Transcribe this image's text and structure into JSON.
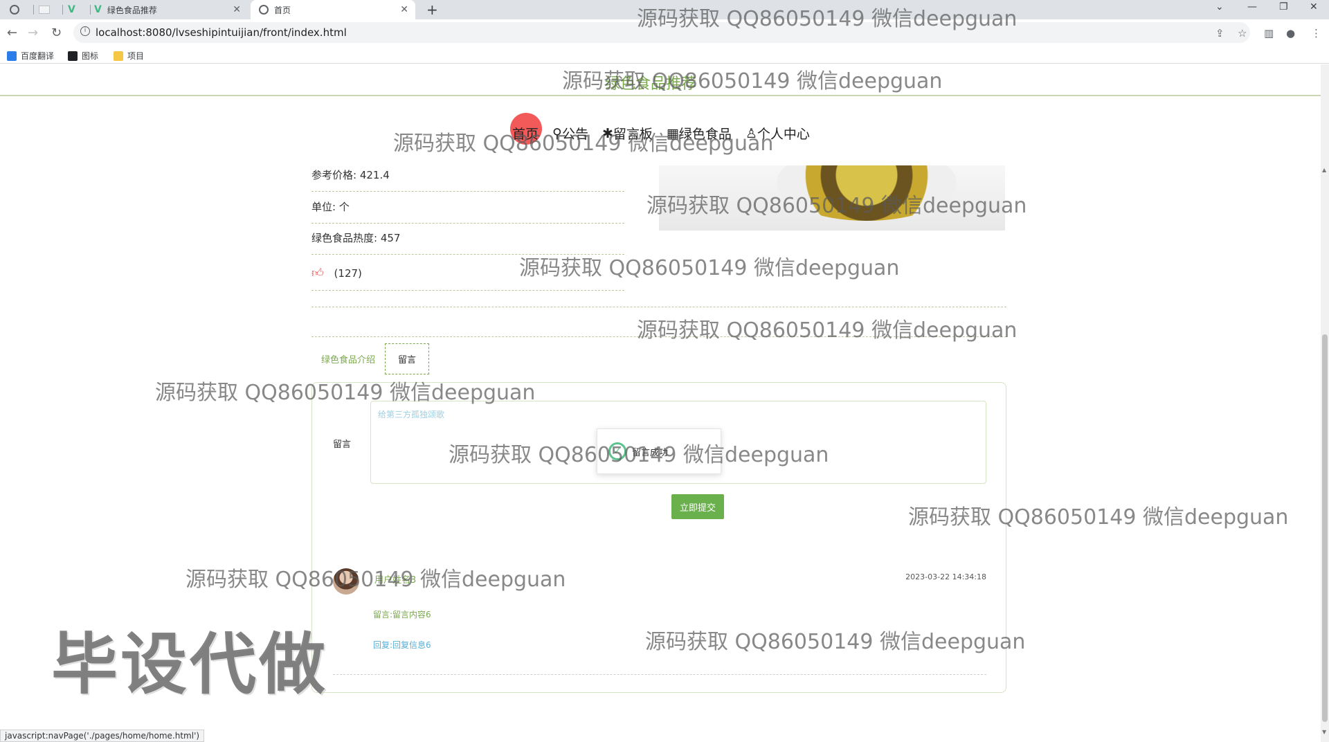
{
  "browser": {
    "tabs": [
      {
        "title": ""
      },
      {
        "title": ""
      },
      {
        "title": ""
      },
      {
        "title": "绿色食品推荐"
      },
      {
        "title": "首页"
      }
    ],
    "url": "localhost:8080/lvseshipintuijian/front/index.html",
    "bookmarks": [
      "百度翻译",
      "图标",
      "项目"
    ],
    "status_url": "javascript:navPage('./pages/home/home.html')"
  },
  "site": {
    "title": "绿色食品推荐",
    "nav": [
      "首页",
      "公告",
      "留言板",
      "绿色食品",
      "个人中心"
    ]
  },
  "product": {
    "price_label": "参考价格: 421.4",
    "unit_label": "单位: 个",
    "heat_label": "绿色食品热度: 457",
    "like_count": "(127)"
  },
  "tabs": {
    "intro": "绿色食品介绍",
    "message": "留言"
  },
  "message_form": {
    "label": "留言",
    "value": "给第三方孤独颂歌",
    "toast": "留言成功",
    "submit": "立即提交"
  },
  "comment": {
    "user": "用户姓名3",
    "time": "2023-03-22 14:34:18",
    "content": "留言:留言内容6",
    "reply": "回复:回复信息6"
  },
  "watermark": {
    "text": "源码获取 QQ86050149 微信deepguan",
    "big": "毕设代做"
  },
  "colors": {
    "accent": "#7aa84f",
    "button": "#6ab04c",
    "like": "#e05050"
  }
}
